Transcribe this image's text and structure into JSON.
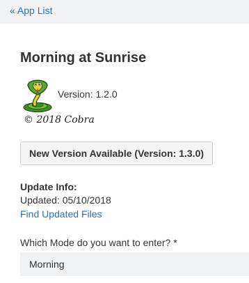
{
  "nav": {
    "back_label": "« App List"
  },
  "app": {
    "title": "Morning at Sunrise",
    "logo_icon": "cobra-snake-icon",
    "version_text": "Version: 1.2.0",
    "copyright": "© 2018 Cobra"
  },
  "update": {
    "button_label": "New Version Available (Version: 1.3.0)",
    "info_heading": "Update Info:",
    "updated_label": "Updated:",
    "updated_date": "05/10/2018",
    "files_link": "Find Updated Files"
  },
  "mode": {
    "question": "Which Mode do you want to enter? *",
    "selected": "Morning"
  },
  "colors": {
    "link": "#2f6fb3",
    "topbar_bg": "#f1f2f4",
    "text": "#333333"
  }
}
